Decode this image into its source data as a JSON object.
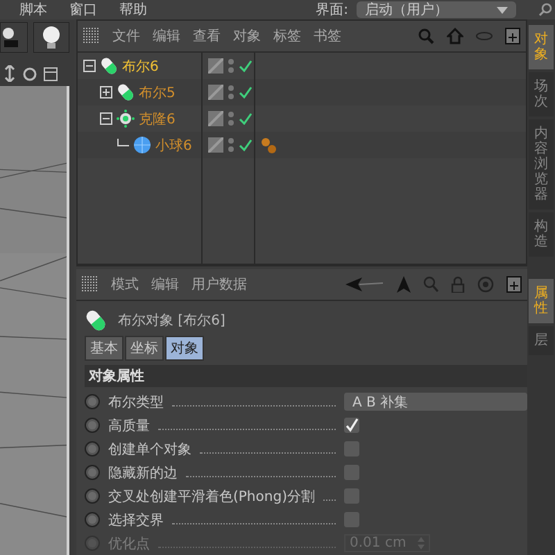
{
  "menu_bar": {
    "items": [
      "脚本",
      "窗口",
      "帮助"
    ],
    "layout_label": "界面:",
    "layout_value": "启动（用户）"
  },
  "object_manager": {
    "menu": [
      "文件",
      "编辑",
      "查看",
      "对象",
      "标签",
      "书签"
    ],
    "objects": [
      {
        "name": "布尔6",
        "kind": "boole",
        "selected": true,
        "expanded": true,
        "has_tag": false,
        "children": [
          {
            "name": "布尔5",
            "kind": "boole",
            "selected": false,
            "expanded": false,
            "has_tag": false
          },
          {
            "name": "克隆6",
            "kind": "cloner",
            "selected": false,
            "expanded": true,
            "has_tag": false,
            "children": [
              {
                "name": "小球6",
                "kind": "sphere",
                "selected": false,
                "has_tag": true
              }
            ]
          }
        ]
      }
    ]
  },
  "attribute_manager": {
    "menu": [
      "模式",
      "编辑",
      "用户数据"
    ],
    "title": "布尔对象 [布尔6]",
    "tabs": [
      {
        "label": "基本",
        "selected": false
      },
      {
        "label": "坐标",
        "selected": false
      },
      {
        "label": "对象",
        "selected": true
      }
    ],
    "section": "对象属性",
    "properties": [
      {
        "label": "布尔类型",
        "kind": "dropdown",
        "value": "A B 补集",
        "disabled": false
      },
      {
        "label": "高质量",
        "kind": "checkbox",
        "checked": true,
        "disabled": false
      },
      {
        "label": "创建单个对象",
        "kind": "checkbox",
        "checked": false,
        "disabled": false
      },
      {
        "label": "隐藏新的边",
        "kind": "checkbox",
        "checked": false,
        "disabled": false
      },
      {
        "label": "交叉处创建平滑着色(Phong)分割",
        "kind": "checkbox",
        "checked": false,
        "disabled": false
      },
      {
        "label": "选择交界",
        "kind": "checkbox",
        "checked": false,
        "disabled": false
      },
      {
        "label": "优化点",
        "kind": "number",
        "value": "0.01 cm",
        "disabled": true
      }
    ]
  },
  "side_tabs": [
    {
      "label": "对象",
      "selected": true
    },
    {
      "label": "场次",
      "selected": false
    },
    {
      "label": "内容浏览器",
      "selected": false
    },
    {
      "label": "构造",
      "selected": false
    },
    {
      "label": "属性",
      "selected": true
    },
    {
      "label": "层",
      "selected": false
    }
  ]
}
